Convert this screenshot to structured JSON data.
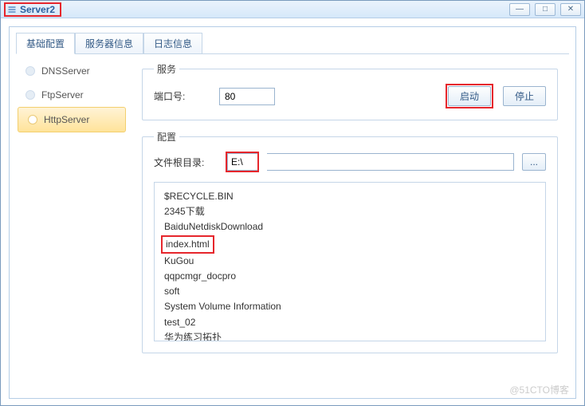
{
  "window": {
    "title": "Server2"
  },
  "tabs": {
    "t0": "基础配置",
    "t1": "服务器信息",
    "t2": "日志信息"
  },
  "sidebar": {
    "items": [
      {
        "label": "DNSServer"
      },
      {
        "label": "FtpServer"
      },
      {
        "label": "HttpServer"
      }
    ]
  },
  "service": {
    "legend": "服务",
    "port_label": "端口号:",
    "port_value": "80",
    "start": "启动",
    "stop": "停止"
  },
  "config": {
    "legend": "配置",
    "root_label": "文件根目录:",
    "root_value": "E:\\",
    "browse": "...",
    "files": [
      "$RECYCLE.BIN",
      "2345下载",
      "BaiduNetdiskDownload",
      "index.html",
      "KuGou",
      "qqpcmgr_docpro",
      "soft",
      "System Volume Information",
      "test_02",
      "华为练习拓扑"
    ],
    "highlight_index": 3
  },
  "watermark": "@51CTO博客"
}
